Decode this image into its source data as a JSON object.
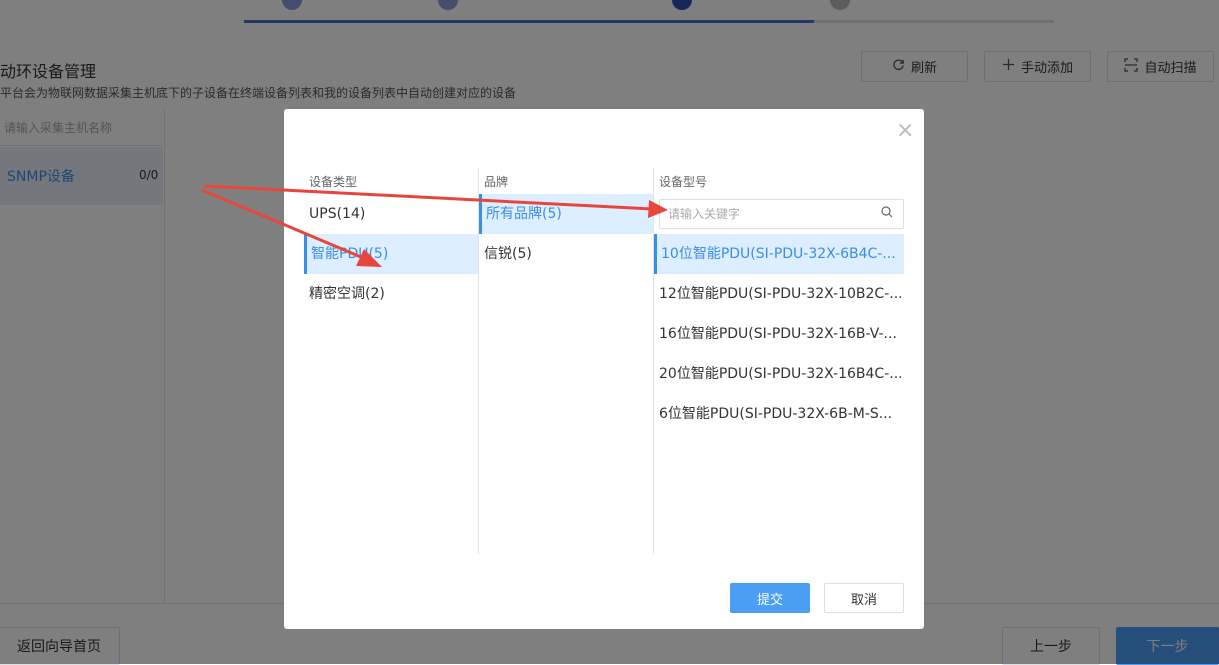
{
  "page": {
    "title": "动环设备管理",
    "subtitle": "平台会为物联网数据采集主机底下的子设备在终端设备列表和我的设备列表中自动创建对应的设备"
  },
  "header_buttons": {
    "refresh": {
      "label": "刷新",
      "icon": "refresh-icon"
    },
    "manual_add": {
      "label": "手动添加",
      "icon": "plus-icon"
    },
    "auto_scan": {
      "label": "自动扫描",
      "icon": "scan-icon"
    }
  },
  "host_panel": {
    "search_placeholder": "请输入采集主机名称",
    "items": [
      {
        "name": "SNMP设备",
        "count": "0/0"
      }
    ]
  },
  "footer": {
    "back_home": "返回向导首页",
    "prev": "上一步",
    "next": "下一步"
  },
  "modal": {
    "close_icon": "close-icon",
    "device_type": {
      "header": "设备类型",
      "items": [
        "UPS(14)",
        "智能PDU(5)",
        "精密空调(2)"
      ],
      "selected": "智能PDU(5)"
    },
    "brand": {
      "header": "品牌",
      "items": [
        "所有品牌(5)",
        "信锐(5)"
      ],
      "selected": "所有品牌(5)"
    },
    "model": {
      "header": "设备型号",
      "search_placeholder": "请输入关键字",
      "items": [
        "10位智能PDU(SI-PDU-32X-6B4C-...",
        "12位智能PDU(SI-PDU-32X-10B2C-...",
        "16位智能PDU(SI-PDU-32X-16B-V-...",
        "20位智能PDU(SI-PDU-32X-16B4C-...",
        "6位智能PDU(SI-PDU-32X-6B-M-S..."
      ],
      "selected": "10位智能PDU(SI-PDU-32X-6B4C-..."
    },
    "submit": "提交",
    "cancel": "取消"
  },
  "colors": {
    "accent": "#3a8ee6",
    "selected_bg": "#dceeff",
    "primary_button": "#4a9ff5",
    "annotation_arrow": "#e8453c"
  }
}
